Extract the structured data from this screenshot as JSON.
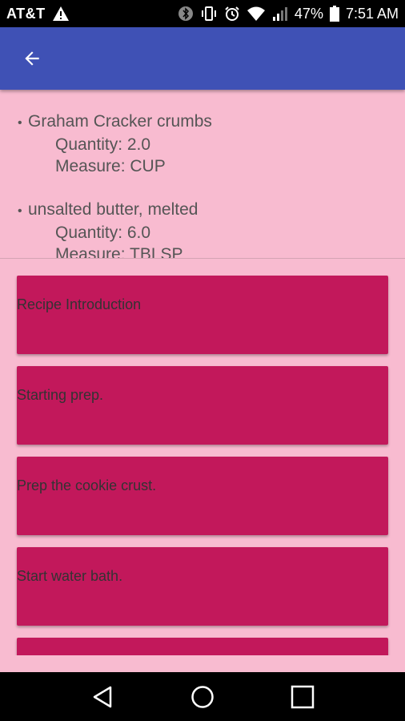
{
  "status_bar": {
    "carrier": "AT&T",
    "battery": "47%",
    "time": "7:51 AM",
    "icons": [
      "warning-icon",
      "bluetooth-icon",
      "vibrate-icon",
      "alarm-icon",
      "wifi-icon",
      "signal-icon",
      "battery-icon"
    ]
  },
  "app_bar": {
    "back_icon": "arrow-back-icon",
    "color": "#3f51b5"
  },
  "ingredients": [
    {
      "name": "Graham Cracker crumbs",
      "quantity": "Quantity: 2.0",
      "measure": "Measure: CUP"
    },
    {
      "name": "unsalted butter, melted",
      "quantity": "Quantity: 6.0",
      "measure": "Measure: TBLSP"
    }
  ],
  "steps": [
    {
      "label": "Recipe Introduction"
    },
    {
      "label": "Starting prep."
    },
    {
      "label": "Prep the cookie crust."
    },
    {
      "label": "Start water bath."
    },
    {
      "label": ""
    }
  ],
  "colors": {
    "background": "#f8bbd0",
    "card": "#c2185b",
    "app_bar": "#3f51b5"
  },
  "nav_bar": {
    "icons": [
      "back-triangle-icon",
      "home-circle-icon",
      "recents-square-icon"
    ]
  }
}
